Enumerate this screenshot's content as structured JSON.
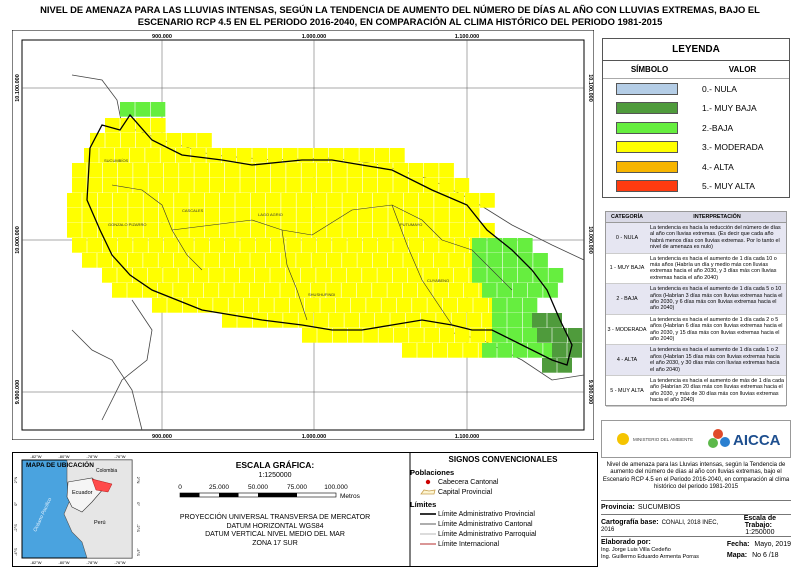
{
  "title": "NIVEL DE AMENAZA PARA LAS LLUVIAS INTENSAS, SEGÚN LA TENDENCIA DE AUMENTO DEL NÚMERO DE DÍAS AL AÑO CON LLUVIAS EXTREMAS, BAJO EL ESCENARIO RCP 4.5 EN EL PERIODO 2016-2040, EN COMPARACIÓN AL CLIMA HISTÓRICO DEL PERIODO 1981-2015",
  "map": {
    "x_ticks": [
      "900.000",
      "1.000.000",
      "1.100.000"
    ],
    "y_ticks": [
      "10.100.000",
      "10.000.000",
      "9.900.000"
    ],
    "cantons": [
      "SUCUMBÍOS",
      "GONZALO PIZARRO",
      "CASCALES",
      "LAGO AGRIO",
      "SHUSHUFINDI",
      "PUTUMAYO",
      "CUYABENO"
    ]
  },
  "legend": {
    "title": "LEYENDA",
    "col_symbol": "SÍMBOLO",
    "col_value": "VALOR",
    "items": [
      {
        "label": "0.- NULA",
        "color": "#b4cde6"
      },
      {
        "label": "1.- MUY BAJA",
        "color": "#4f9b3c"
      },
      {
        "label": "2.-BAJA",
        "color": "#66ee3f"
      },
      {
        "label": "3.- MODERADA",
        "color": "#ffff00"
      },
      {
        "label": "4.- ALTA",
        "color": "#f7b500"
      },
      {
        "label": "5.- MUY ALTA",
        "color": "#ff3b10"
      }
    ]
  },
  "interpretation": {
    "col_category": "CATEGORÍA",
    "col_interp": "INTERPRETACIÓN",
    "rows": [
      {
        "cat": "0 - NULA",
        "text": "La tendencia es hacia la reducción del número de días al año con lluvias extremas. (Es decir que cada año habrá menos días con lluvias extremas. Por lo tanto el nivel de amenaza es nulo)"
      },
      {
        "cat": "1 - MUY BAJA",
        "text": "La tendencia es hacia el aumento de 1 día cada 10 o más años (Habría un día y medio más con lluvias extremas hacia el año 2030, y 3 días más con lluvias extremas hacia el año 2040)"
      },
      {
        "cat": "2 - BAJA",
        "text": "La tendencia es hacia el aumento de 1 día cada 5 o 10 años (Habrían 3 días más con lluvias extremas hacia el año 2030, y 6 días más con lluvias extremas hacia el año 2040)"
      },
      {
        "cat": "3 - MODERADA",
        "text": "La tendencia es hacia el aumento de 1 día cada 2 o 5 años (Habrían 6 días más con lluvias extremas hacia el año 2030, y 15 días más con lluvias extremas hacia el año 2040)"
      },
      {
        "cat": "4 - ALTA",
        "text": "La tendencia es hacia el aumento de 1 día cada 1 o 2 años (Habrían 15 días más con lluvias extremas hacia el año 2030, y 30 días más con lluvias extremas hacia el año 2040)"
      },
      {
        "cat": "5 - MUY ALTA",
        "text": "La tendencia es hacia el aumento de más de 1 día cada año (Habrían 20 días más con lluvias extremas hacia el año 2030, y más de 30 días más con lluvias extremas hacia el año 2040)"
      }
    ]
  },
  "logos": {
    "ministry": "MINISTERIO DEL AMBIENTE",
    "project": "AICCA"
  },
  "description": "Nivel de amenaza para las Lluvias intensas, según la Tendencia de aumento del número de días al año con lluvias extremas, bajo el Escenario RCP 4.5 en el Periodo 2016-2040, en comparación al clima histórico del periodo 1981-2015",
  "info": {
    "province_label": "Provincia:",
    "province": "SUCUMBIOS",
    "base_label": "Cartografía base:",
    "base": "CONALI, 2018 INEC, 2016",
    "scale_label": "Escala de Trabajo:",
    "scale": "1:250000",
    "made_by_label": "Elaborado por:",
    "made_by_1": "Ing. Jorge Luis Villa Cedeño",
    "made_by_2": "Ing. Guillermo Eduardo Armenta Porras",
    "date_label": "Fecha:",
    "date": "Mayo, 2019",
    "map_label": "Mapa:",
    "map_no": "No 6 /18"
  },
  "location_map": {
    "title": "MAPA DE UBICACIÓN",
    "countries": [
      "Colombia",
      "Ecuador",
      "Perú"
    ],
    "ocean": "Océano Pacífico",
    "lon_ticks": [
      "-82°W",
      "-80°W",
      "-78°W",
      "-76°W"
    ],
    "lat_ticks": [
      "2°N",
      "0°",
      "-2°S",
      "-4°S"
    ]
  },
  "scale_bar": {
    "heading": "ESCALA GRÁFICA:",
    "ratio": "1:1250000",
    "ticks": [
      "0",
      "25.000",
      "50.000",
      "75.000",
      "100.000"
    ],
    "unit": "Metros"
  },
  "projection": [
    "PROYECCIÓN UNIVERSAL TRANSVERSA DE MERCATOR",
    "DATUM HORIZONTAL WGS84",
    "DATUM VERTICAL NIVEL MEDIO DEL MAR",
    "ZONA 17 SUR"
  ],
  "signs": {
    "heading": "SIGNOS CONVENCIONALES",
    "populations": "Poblaciones",
    "cabecera": "Cabecera Cantonal",
    "capital": "Capital Provincial",
    "limits": "Límites",
    "prov": "Límite Administrativo Provincial",
    "cant": "Límite Administrativo Cantonal",
    "parr": "Límite Administrativo Parroquial",
    "intl": "Límite Internacional"
  }
}
